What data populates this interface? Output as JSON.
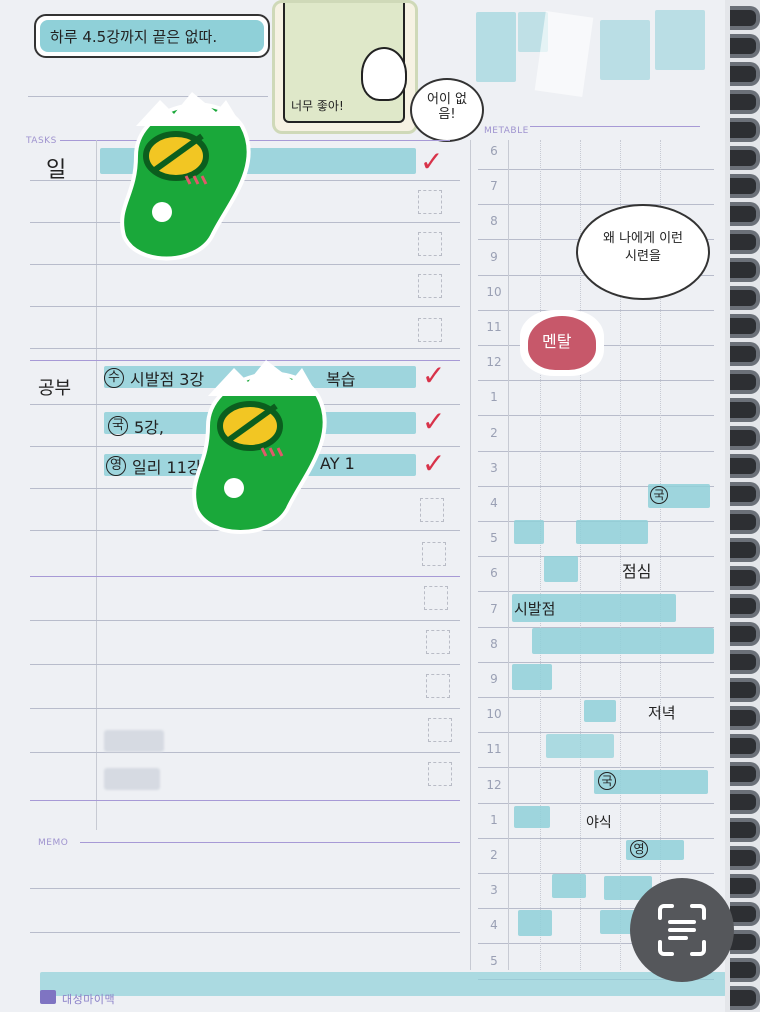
{
  "sections": {
    "tasks": "TASKS",
    "timetable": "METABLE",
    "memo": "MEMO"
  },
  "header": {
    "note": "하루 4.5강까지 끝은 없따."
  },
  "sticker": {
    "caption": "너무 좋아!",
    "badge": "어이 없음!",
    "speech": "왜 나에게 이런 시련을",
    "heart": "멘탈"
  },
  "tasks": {
    "work_label": "일",
    "study_label": "공부",
    "study_items": [
      {
        "mark": "수",
        "text": "시발점 3강",
        "tail": "복습"
      },
      {
        "mark": "국",
        "text": "5강,",
        "tail": ""
      },
      {
        "mark": "영",
        "text": "일리 11강",
        "tail": "AY 1"
      }
    ]
  },
  "timetable": {
    "hours": [
      "6",
      "7",
      "8",
      "9",
      "10",
      "11",
      "12",
      "1",
      "2",
      "3",
      "4",
      "5",
      "6",
      "7",
      "8",
      "9",
      "10",
      "11",
      "12",
      "1",
      "2",
      "3",
      "4",
      "5"
    ],
    "notes": {
      "lunch": "점심",
      "math": "시발점",
      "dinner": "저녁",
      "snack": "야식",
      "mark_guk1": "국",
      "mark_guk2": "국",
      "mark_yeong": "영"
    }
  },
  "footer": {
    "brand": "대성마이맥"
  },
  "colors": {
    "highlighter": "#8fd0d8",
    "tick": "#d8334a",
    "rule": "#a79ad6",
    "sticker_green": "#1aa83a"
  },
  "icons": [
    "scan-text-icon",
    "green-sticker-icon"
  ]
}
